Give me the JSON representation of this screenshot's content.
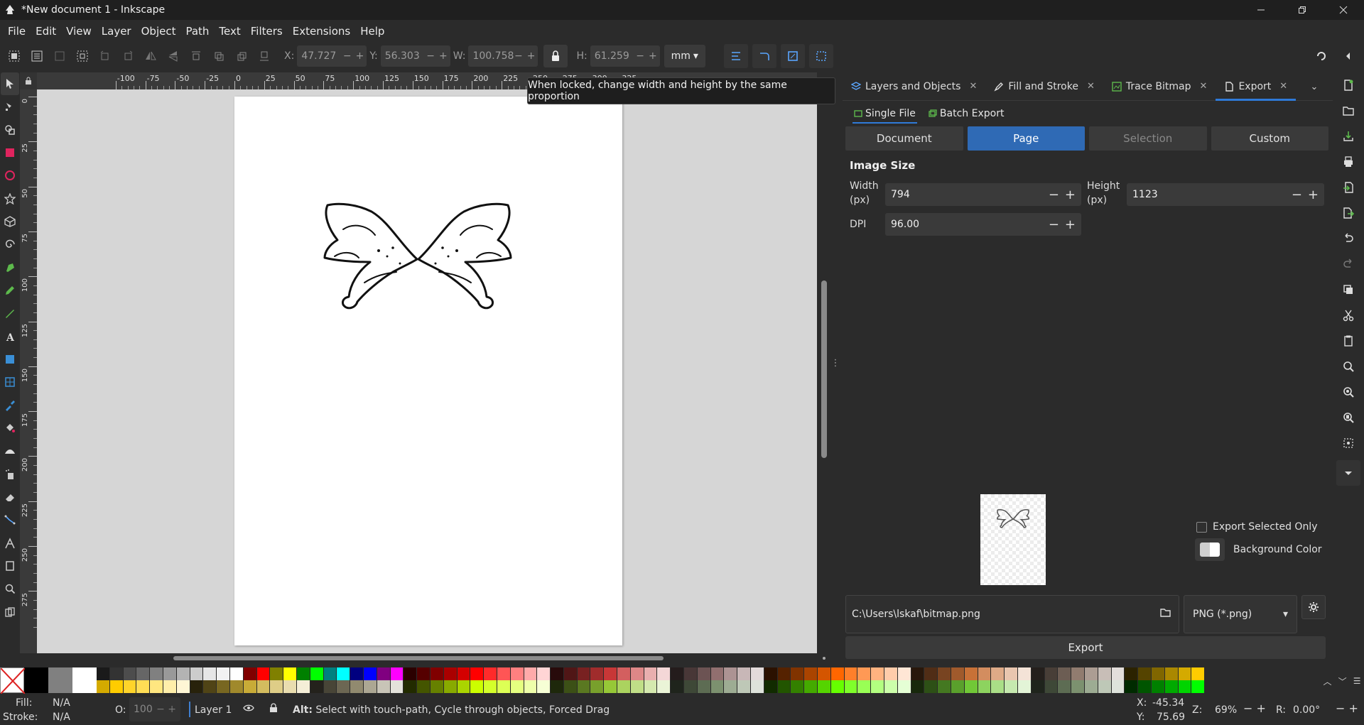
{
  "window": {
    "title": "*New document 1 - Inkscape"
  },
  "menu": [
    "File",
    "Edit",
    "View",
    "Layer",
    "Object",
    "Path",
    "Text",
    "Filters",
    "Extensions",
    "Help"
  ],
  "toolbar": {
    "x_label": "X:",
    "x_value": "47.727",
    "y_label": "Y:",
    "y_value": "56.303",
    "w_label": "W:",
    "w_value": "100.758",
    "h_label": "H:",
    "h_value": "61.259",
    "units": "mm"
  },
  "tooltip": "When locked, change width and height by the same proportion",
  "ruler_h_labels": [
    "-100",
    "-75",
    "-50",
    "-25",
    "0",
    "25",
    "50",
    "75",
    "100",
    "125",
    "150",
    "175",
    "200",
    "225",
    "250",
    "275",
    "300",
    "325"
  ],
  "ruler_v_labels": [
    "0",
    "25",
    "50",
    "75",
    "100",
    "125",
    "150",
    "175",
    "200",
    "225",
    "250",
    "275"
  ],
  "dock": {
    "tabs": [
      {
        "label": "Layers and Objects",
        "icon": "layers-icon"
      },
      {
        "label": "Fill and Stroke",
        "icon": "fill-stroke-icon"
      },
      {
        "label": "Trace Bitmap",
        "icon": "trace-bitmap-icon"
      },
      {
        "label": "Export",
        "icon": "export-icon"
      }
    ],
    "subtabs": [
      "Single File",
      "Batch Export"
    ],
    "segments": [
      "Document",
      "Page",
      "Selection",
      "Custom"
    ],
    "image_size_title": "Image Size",
    "width_label": "Width\n(px)",
    "width_value": "794",
    "height_label": "Height\n(px)",
    "height_value": "1123",
    "dpi_label": "DPI",
    "dpi_value": "96.00",
    "export_selected_only": "Export Selected Only",
    "background_color": "Background Color",
    "file_path": "C:\\Users\\lskaf\\bitmap.png",
    "format": "PNG (*.png)",
    "export_button": "Export"
  },
  "colors": {
    "accent": "#2f6ab5",
    "tab_underline": "#2f7ad8",
    "panel_bg": "#2b2b2b",
    "field_bg": "#3a3a3a",
    "canvas_bg": "#d6d6d6"
  },
  "palette": {
    "main": [
      "#000000",
      "#808080",
      "#ffffff"
    ],
    "top": [
      "#1a1a1a",
      "#333333",
      "#4d4d4d",
      "#666666",
      "#808080",
      "#999999",
      "#b3b3b3",
      "#cccccc",
      "#e6e6e6",
      "#f2f2f2",
      "#ffffff",
      "#800000",
      "#ff0000",
      "#808000",
      "#ffff00",
      "#008000",
      "#00ff00",
      "#008080",
      "#00ffff",
      "#000080",
      "#0000ff",
      "#800080",
      "#ff00ff",
      "#2b0000",
      "#550000",
      "#800000",
      "#aa0000",
      "#d40000",
      "#ff0000",
      "#ff2a2a",
      "#ff5555",
      "#ff8080",
      "#ffaaaa",
      "#ffd5d5",
      "#280b0b",
      "#501616",
      "#782121",
      "#a02c2c",
      "#c83737",
      "#d35f5f",
      "#de8787",
      "#e9afaf",
      "#f4d7d7",
      "#241c1c",
      "#483737",
      "#6c5353",
      "#916f6f",
      "#ac9393",
      "#c8b7b7",
      "#e3dbdb",
      "#2b1100",
      "#552200",
      "#803300",
      "#aa4400",
      "#d45500",
      "#ff6600",
      "#ff7f2a",
      "#ff9955",
      "#ffb380",
      "#ffccaa",
      "#ffe6d5",
      "#28170b",
      "#502d16",
      "#784421",
      "#a05a2c",
      "#c87137",
      "#d38d5f",
      "#deaa87",
      "#e9c6af",
      "#f4e3d7",
      "#241f1c",
      "#483e37",
      "#6c5d53",
      "#917c6f",
      "#ac9d93",
      "#c8beb7",
      "#e3dedb",
      "#2b2200",
      "#554400",
      "#806600",
      "#aa8800",
      "#d4aa00",
      "#ffcc00"
    ],
    "bottom": [
      "#d4aa00",
      "#ffcc00",
      "#ffd42a",
      "#ffdd55",
      "#ffe680",
      "#ffeeaa",
      "#fff6d5",
      "#28220b",
      "#504416",
      "#786721",
      "#a0892c",
      "#c8ab37",
      "#d3bc5f",
      "#decd87",
      "#e9ddaf",
      "#f4eed7",
      "#24221c",
      "#484537",
      "#6c6753",
      "#918a6f",
      "#aca793",
      "#c8c4b7",
      "#e3e2db",
      "#222b00",
      "#445500",
      "#668000",
      "#88aa00",
      "#aad400",
      "#ccff00",
      "#d4ff2a",
      "#ddff55",
      "#e5ff80",
      "#eeffaa",
      "#f6ffd5",
      "#1e280b",
      "#3c5016",
      "#5a7821",
      "#78a02c",
      "#96c837",
      "#abd35f",
      "#c0de87",
      "#d5e9af",
      "#eaf4d7",
      "#1f241c",
      "#3e4837",
      "#5d6c53",
      "#7c916f",
      "#9dac93",
      "#bec8b7",
      "#dee3db",
      "#112b00",
      "#225500",
      "#338000",
      "#44aa00",
      "#55d400",
      "#66ff00",
      "#7fff2a",
      "#99ff55",
      "#b3ff80",
      "#ccffaa",
      "#e5ffd5",
      "#17280b",
      "#2d5016",
      "#447821",
      "#5aa02c",
      "#71c837",
      "#8dd35f",
      "#aade87",
      "#c6e9af",
      "#e3f4d7",
      "#1f241c",
      "#3e4837",
      "#5d6c53",
      "#7c916f",
      "#9dac93",
      "#bec8b7",
      "#dee3db",
      "#002b00",
      "#005500",
      "#008000",
      "#00aa00",
      "#00d400",
      "#00ff00"
    ]
  },
  "status": {
    "fill_label": "Fill:",
    "fill_value": "N/A",
    "stroke_label": "Stroke:",
    "stroke_value": "N/A",
    "opacity_label": "O:",
    "opacity_value": "100",
    "layer": "Layer 1",
    "hint_bold": "Alt:",
    "hint": " Select with touch-path, Cycle through objects, Forced Drag",
    "cursor_x_label": "X:",
    "cursor_x": "-45.34",
    "cursor_y_label": "Y:",
    "cursor_y": "75.69",
    "zoom_label": "Z:",
    "zoom": "69%",
    "rotation_label": "R:",
    "rotation": "0.00°"
  }
}
